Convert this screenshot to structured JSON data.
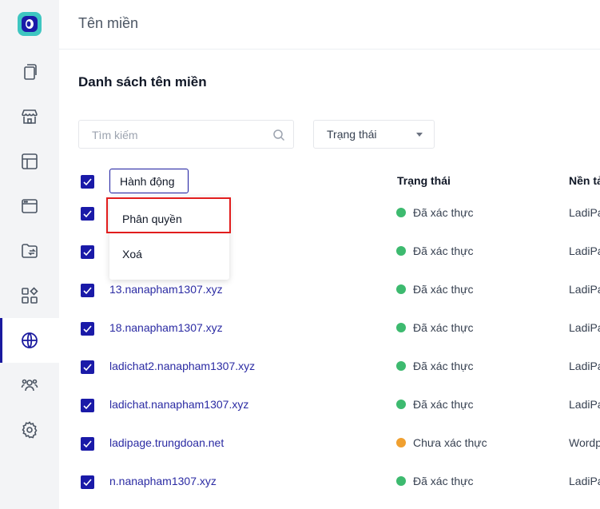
{
  "header": {
    "title": "Tên miền"
  },
  "section": {
    "title": "Danh sách tên miền"
  },
  "filters": {
    "search_placeholder": "Tìm kiếm",
    "status_label": "Trạng thái"
  },
  "table": {
    "action_button": "Hành động",
    "columns": [
      "Trạng thái",
      "Nền tả"
    ],
    "rows": [
      {
        "domain": "",
        "status": "Đã xác thực",
        "status_color": "#3dba6f",
        "platform": "LadiPa"
      },
      {
        "domain": "",
        "status": "Đã xác thực",
        "status_color": "#3dba6f",
        "platform": "LadiPa"
      },
      {
        "domain": "13.nanapham1307.xyz",
        "status": "Đã xác thực",
        "status_color": "#3dba6f",
        "platform": "LadiPa"
      },
      {
        "domain": "18.nanapham1307.xyz",
        "status": "Đã xác thực",
        "status_color": "#3dba6f",
        "platform": "LadiPa"
      },
      {
        "domain": "ladichat2.nanapham1307.xyz",
        "status": "Đã xác thực",
        "status_color": "#3dba6f",
        "platform": "LadiPa"
      },
      {
        "domain": "ladichat.nanapham1307.xyz",
        "status": "Đã xác thực",
        "status_color": "#3dba6f",
        "platform": "LadiPa"
      },
      {
        "domain": "ladipage.trungdoan.net",
        "status": "Chưa xác thực",
        "status_color": "#f0a030",
        "platform": "Wordp"
      },
      {
        "domain": "n.nanapham1307.xyz",
        "status": "Đã xác thực",
        "status_color": "#3dba6f",
        "platform": "LadiPa"
      }
    ]
  },
  "dropdown": {
    "items": [
      "Phân quyền",
      "Xoá"
    ]
  },
  "sidebar": {
    "icons": [
      "pages-icon",
      "store-icon",
      "layout-icon",
      "browser-icon",
      "folder-icon",
      "apps-icon",
      "globe-icon",
      "users-icon",
      "gear-icon"
    ],
    "active": "globe-icon"
  },
  "colors": {
    "accent": "#1a1aa8",
    "highlight": "#e11d1d"
  }
}
